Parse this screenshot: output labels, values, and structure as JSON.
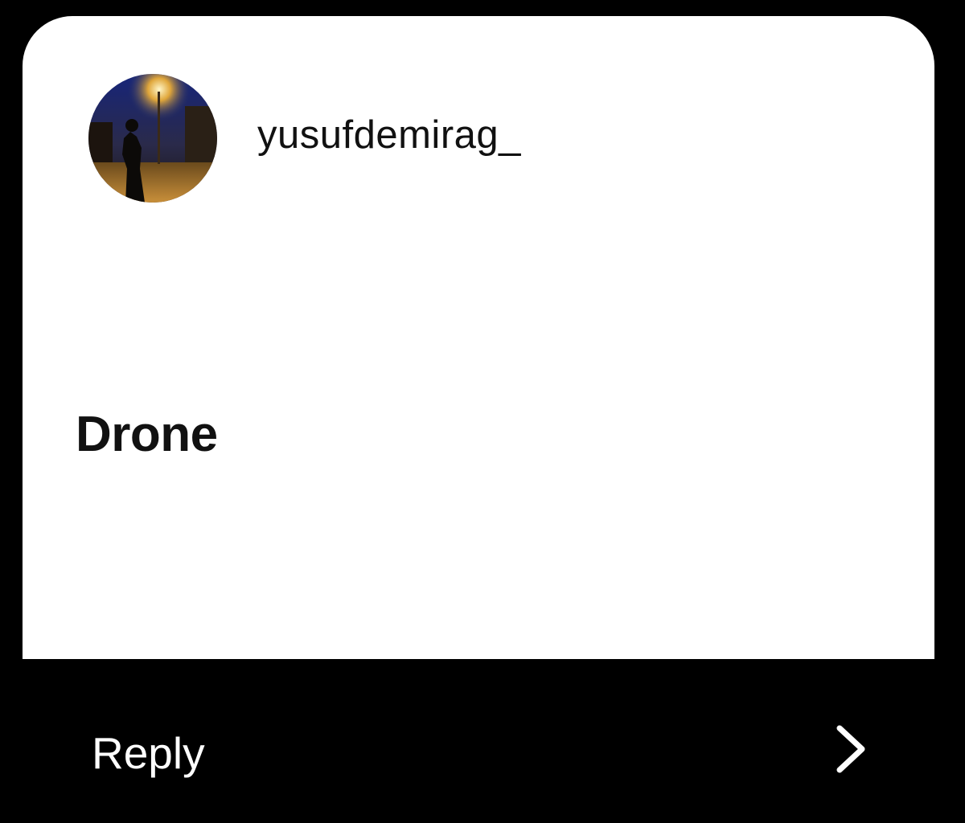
{
  "story_reply": {
    "author": {
      "username": "yusufdemirag_"
    },
    "message": "Drone",
    "reply": {
      "label": "Reply",
      "icon": "chevron-right-icon"
    }
  },
  "colors": {
    "background": "#000000",
    "card": "#ffffff",
    "text_dark": "#111111",
    "text_light": "#ffffff"
  }
}
